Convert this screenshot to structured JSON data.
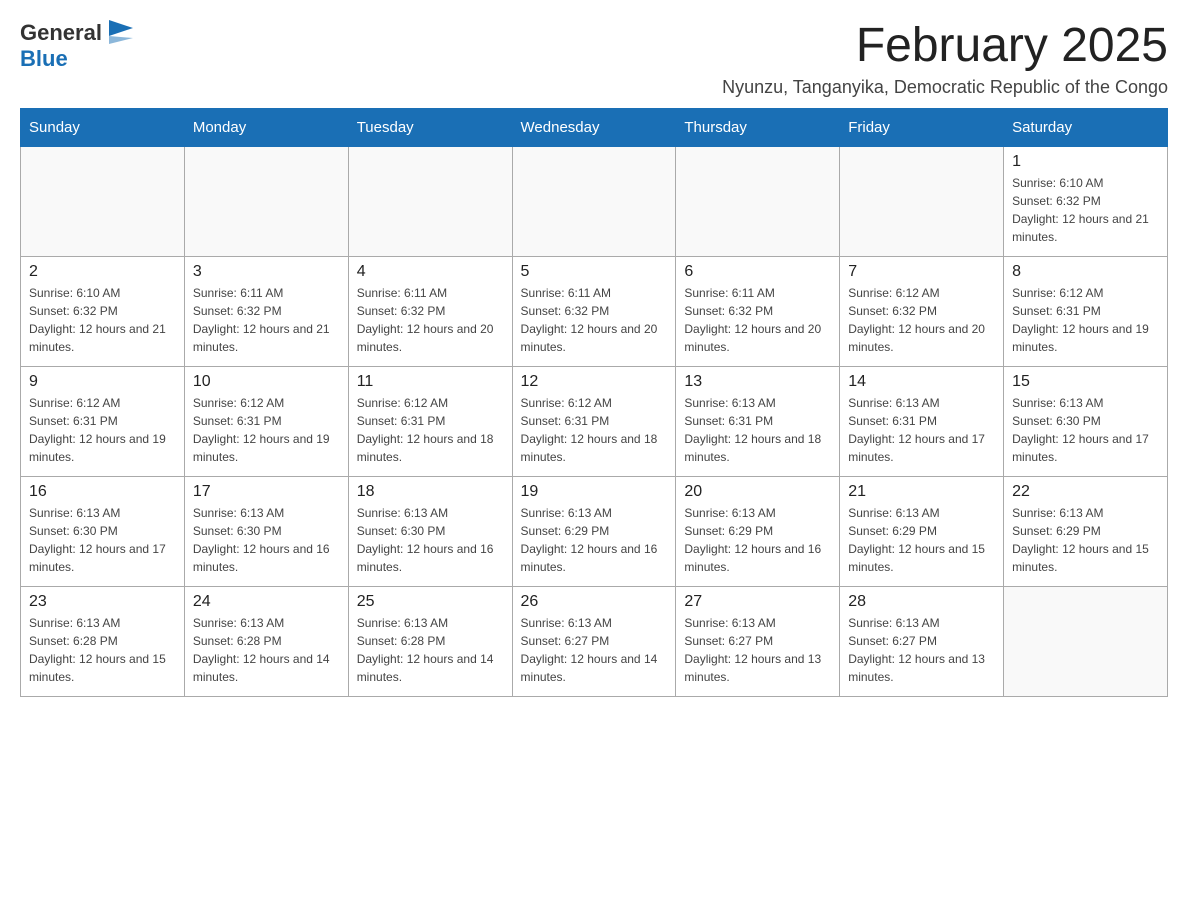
{
  "header": {
    "logo_general": "General",
    "logo_blue": "Blue",
    "month_title": "February 2025",
    "location": "Nyunzu, Tanganyika, Democratic Republic of the Congo"
  },
  "weekdays": [
    "Sunday",
    "Monday",
    "Tuesday",
    "Wednesday",
    "Thursday",
    "Friday",
    "Saturday"
  ],
  "weeks": [
    [
      {
        "day": "",
        "info": ""
      },
      {
        "day": "",
        "info": ""
      },
      {
        "day": "",
        "info": ""
      },
      {
        "day": "",
        "info": ""
      },
      {
        "day": "",
        "info": ""
      },
      {
        "day": "",
        "info": ""
      },
      {
        "day": "1",
        "info": "Sunrise: 6:10 AM\nSunset: 6:32 PM\nDaylight: 12 hours and 21 minutes."
      }
    ],
    [
      {
        "day": "2",
        "info": "Sunrise: 6:10 AM\nSunset: 6:32 PM\nDaylight: 12 hours and 21 minutes."
      },
      {
        "day": "3",
        "info": "Sunrise: 6:11 AM\nSunset: 6:32 PM\nDaylight: 12 hours and 21 minutes."
      },
      {
        "day": "4",
        "info": "Sunrise: 6:11 AM\nSunset: 6:32 PM\nDaylight: 12 hours and 20 minutes."
      },
      {
        "day": "5",
        "info": "Sunrise: 6:11 AM\nSunset: 6:32 PM\nDaylight: 12 hours and 20 minutes."
      },
      {
        "day": "6",
        "info": "Sunrise: 6:11 AM\nSunset: 6:32 PM\nDaylight: 12 hours and 20 minutes."
      },
      {
        "day": "7",
        "info": "Sunrise: 6:12 AM\nSunset: 6:32 PM\nDaylight: 12 hours and 20 minutes."
      },
      {
        "day": "8",
        "info": "Sunrise: 6:12 AM\nSunset: 6:31 PM\nDaylight: 12 hours and 19 minutes."
      }
    ],
    [
      {
        "day": "9",
        "info": "Sunrise: 6:12 AM\nSunset: 6:31 PM\nDaylight: 12 hours and 19 minutes."
      },
      {
        "day": "10",
        "info": "Sunrise: 6:12 AM\nSunset: 6:31 PM\nDaylight: 12 hours and 19 minutes."
      },
      {
        "day": "11",
        "info": "Sunrise: 6:12 AM\nSunset: 6:31 PM\nDaylight: 12 hours and 18 minutes."
      },
      {
        "day": "12",
        "info": "Sunrise: 6:12 AM\nSunset: 6:31 PM\nDaylight: 12 hours and 18 minutes."
      },
      {
        "day": "13",
        "info": "Sunrise: 6:13 AM\nSunset: 6:31 PM\nDaylight: 12 hours and 18 minutes."
      },
      {
        "day": "14",
        "info": "Sunrise: 6:13 AM\nSunset: 6:31 PM\nDaylight: 12 hours and 17 minutes."
      },
      {
        "day": "15",
        "info": "Sunrise: 6:13 AM\nSunset: 6:30 PM\nDaylight: 12 hours and 17 minutes."
      }
    ],
    [
      {
        "day": "16",
        "info": "Sunrise: 6:13 AM\nSunset: 6:30 PM\nDaylight: 12 hours and 17 minutes."
      },
      {
        "day": "17",
        "info": "Sunrise: 6:13 AM\nSunset: 6:30 PM\nDaylight: 12 hours and 16 minutes."
      },
      {
        "day": "18",
        "info": "Sunrise: 6:13 AM\nSunset: 6:30 PM\nDaylight: 12 hours and 16 minutes."
      },
      {
        "day": "19",
        "info": "Sunrise: 6:13 AM\nSunset: 6:29 PM\nDaylight: 12 hours and 16 minutes."
      },
      {
        "day": "20",
        "info": "Sunrise: 6:13 AM\nSunset: 6:29 PM\nDaylight: 12 hours and 16 minutes."
      },
      {
        "day": "21",
        "info": "Sunrise: 6:13 AM\nSunset: 6:29 PM\nDaylight: 12 hours and 15 minutes."
      },
      {
        "day": "22",
        "info": "Sunrise: 6:13 AM\nSunset: 6:29 PM\nDaylight: 12 hours and 15 minutes."
      }
    ],
    [
      {
        "day": "23",
        "info": "Sunrise: 6:13 AM\nSunset: 6:28 PM\nDaylight: 12 hours and 15 minutes."
      },
      {
        "day": "24",
        "info": "Sunrise: 6:13 AM\nSunset: 6:28 PM\nDaylight: 12 hours and 14 minutes."
      },
      {
        "day": "25",
        "info": "Sunrise: 6:13 AM\nSunset: 6:28 PM\nDaylight: 12 hours and 14 minutes."
      },
      {
        "day": "26",
        "info": "Sunrise: 6:13 AM\nSunset: 6:27 PM\nDaylight: 12 hours and 14 minutes."
      },
      {
        "day": "27",
        "info": "Sunrise: 6:13 AM\nSunset: 6:27 PM\nDaylight: 12 hours and 13 minutes."
      },
      {
        "day": "28",
        "info": "Sunrise: 6:13 AM\nSunset: 6:27 PM\nDaylight: 12 hours and 13 minutes."
      },
      {
        "day": "",
        "info": ""
      }
    ]
  ]
}
